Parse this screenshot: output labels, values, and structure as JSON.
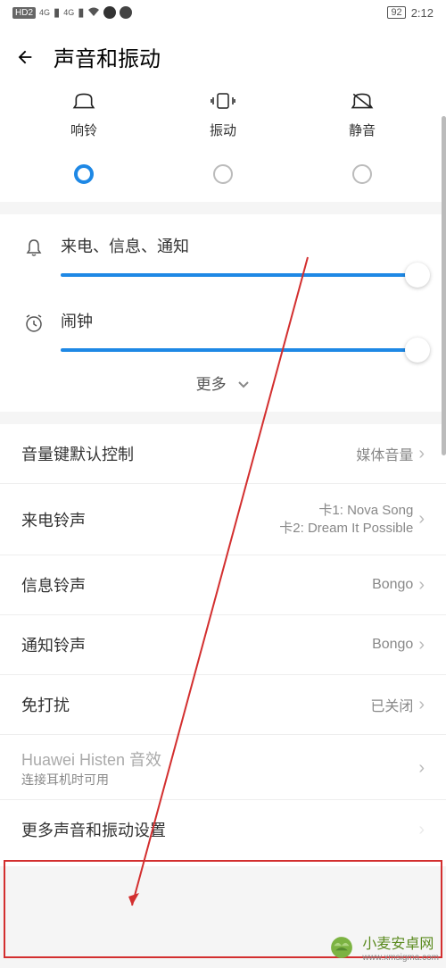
{
  "status": {
    "hd_badge": "HD2",
    "sig1": "4G",
    "sig2": "4G",
    "battery": "92",
    "time": "2:12"
  },
  "header": {
    "title": "声音和振动"
  },
  "modes": {
    "ring": "响铃",
    "vibrate": "振动",
    "silent": "静音"
  },
  "sliders": {
    "calls_label": "来电、信息、通知",
    "alarm_label": "闹钟",
    "more": "更多"
  },
  "rows": {
    "volume_key": {
      "title": "音量键默认控制",
      "value": "媒体音量"
    },
    "ringtone": {
      "title": "来电铃声",
      "sim1": "卡1: Nova Song",
      "sim2": "卡2: Dream It Possible"
    },
    "message": {
      "title": "信息铃声",
      "value": "Bongo"
    },
    "notification": {
      "title": "通知铃声",
      "value": "Bongo"
    },
    "dnd": {
      "title": "免打扰",
      "value": "已关闭"
    },
    "histen": {
      "title": "Huawei Histen 音效",
      "sub": "连接耳机时可用"
    },
    "more_settings": {
      "title": "更多声音和振动设置"
    }
  },
  "watermark": {
    "text": "小麦安卓网",
    "url": "www.xmsigma.com"
  }
}
